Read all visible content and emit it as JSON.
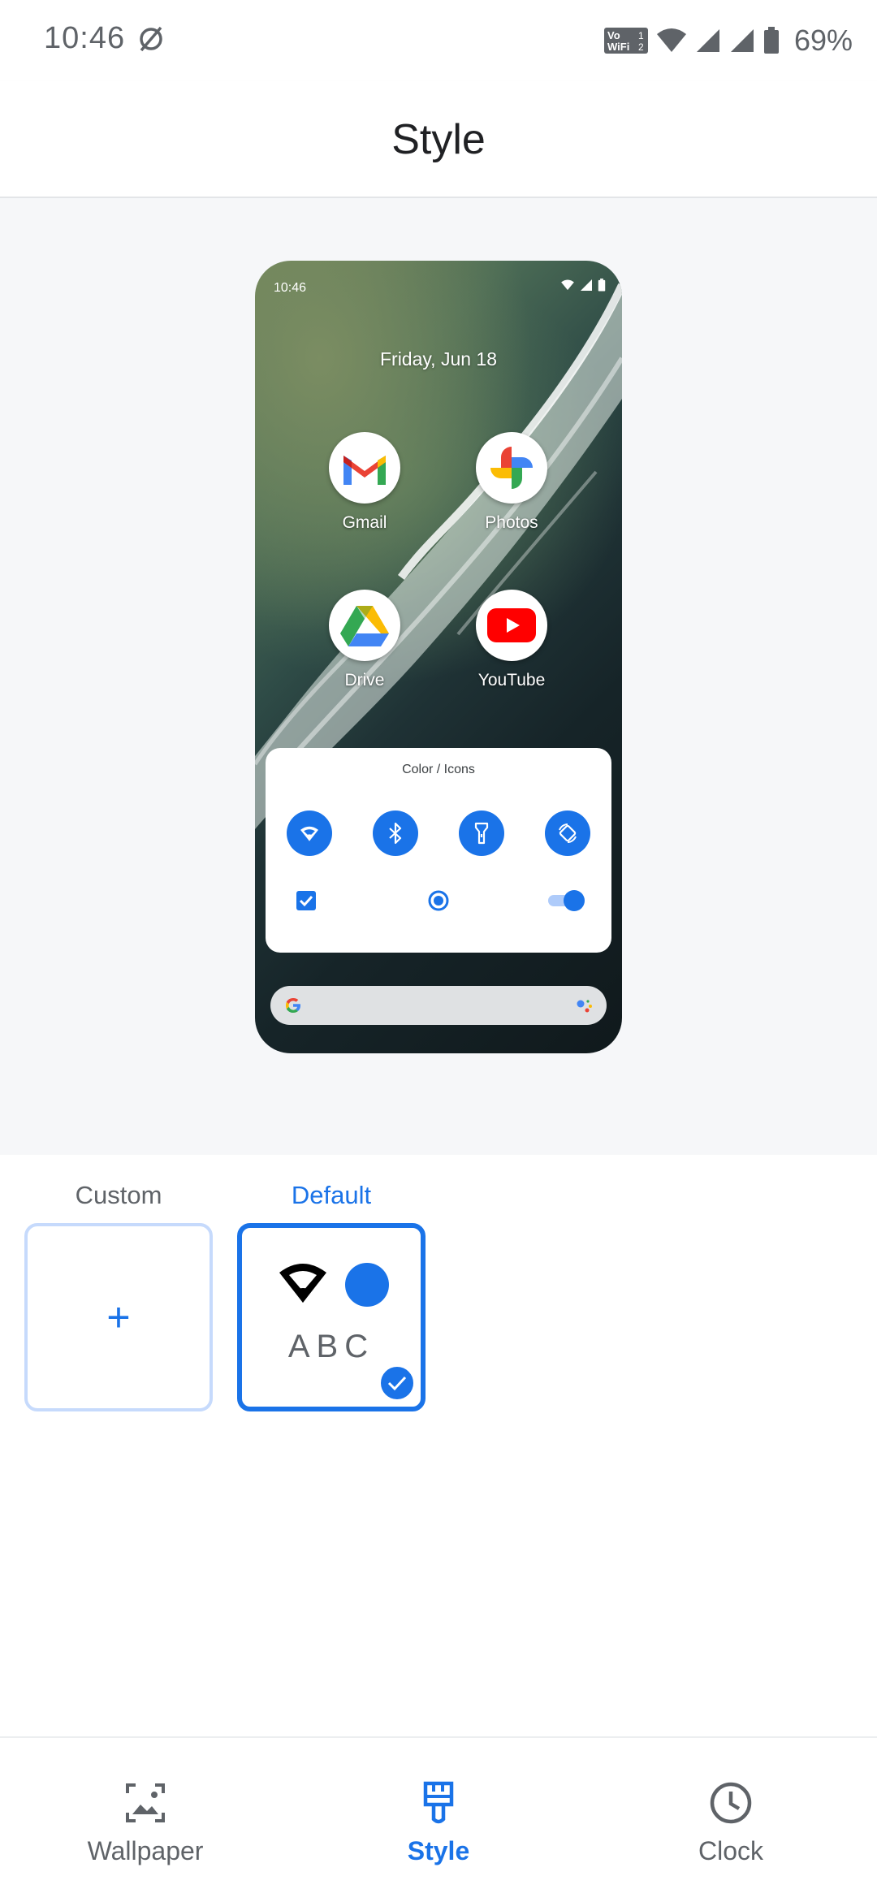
{
  "status_bar": {
    "time": "10:46",
    "battery_percent": "69%",
    "icons": [
      "no-disturb-icon",
      "volte-wifi-icon",
      "wifi-icon",
      "signal-icon",
      "signal-icon",
      "battery-icon"
    ]
  },
  "header": {
    "title": "Style"
  },
  "preview": {
    "time": "10:46",
    "date": "Friday, Jun 18",
    "apps": [
      {
        "label": "Gmail",
        "icon": "gmail-icon"
      },
      {
        "label": "Photos",
        "icon": "photos-icon"
      },
      {
        "label": "Drive",
        "icon": "drive-icon"
      },
      {
        "label": "YouTube",
        "icon": "youtube-icon"
      }
    ],
    "quick_settings": {
      "title": "Color / Icons",
      "tiles": [
        "wifi-icon",
        "bluetooth-icon",
        "flashlight-icon",
        "auto-rotate-icon"
      ],
      "controls": [
        "checkbox",
        "radio",
        "switch"
      ]
    }
  },
  "options": {
    "custom": {
      "label": "Custom",
      "add_symbol": "+"
    },
    "default": {
      "label": "Default",
      "sample_text": "ABC",
      "selected": true
    }
  },
  "bottom_nav": {
    "items": [
      {
        "label": "Wallpaper",
        "icon": "wallpaper-icon",
        "active": false
      },
      {
        "label": "Style",
        "icon": "style-brush-icon",
        "active": true
      },
      {
        "label": "Clock",
        "icon": "clock-icon",
        "active": false
      }
    ]
  },
  "colors": {
    "accent": "#1a73e8",
    "text_secondary": "#5f6368",
    "preview_background": "#f6f7f9"
  }
}
